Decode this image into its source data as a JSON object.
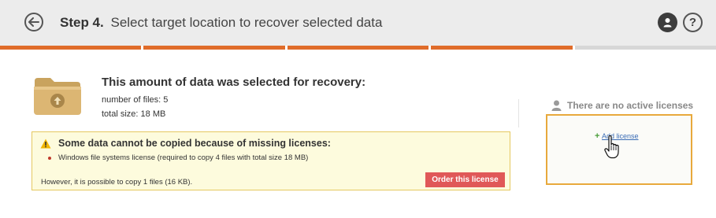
{
  "header": {
    "step_label": "Step 4.",
    "title": "Select target location to recover selected data",
    "back_icon": "arrow-left-icon",
    "user_icon": "user-icon",
    "help_icon": "question-icon",
    "help_glyph": "?"
  },
  "progress": {
    "completed_steps": 4,
    "total_steps": 5,
    "accent_color": "#e06c2a"
  },
  "summary": {
    "headline": "This amount of data was selected for recovery:",
    "files_text": "number of files: 5",
    "size_text": "total size: 18 MB"
  },
  "warning": {
    "title": "Some data cannot be copied because of missing licenses:",
    "items": [
      "Windows file systems license (required to copy 4 files with total size 18 MB)"
    ],
    "footer": "However, it is possible to copy 1 files (16 KB).",
    "order_button": "Order this license",
    "button_color": "#e05858"
  },
  "licenses": {
    "status": "There are no active licenses",
    "add_plus": "+",
    "add_link": "Add license",
    "highlight_color": "#e8a93c"
  }
}
